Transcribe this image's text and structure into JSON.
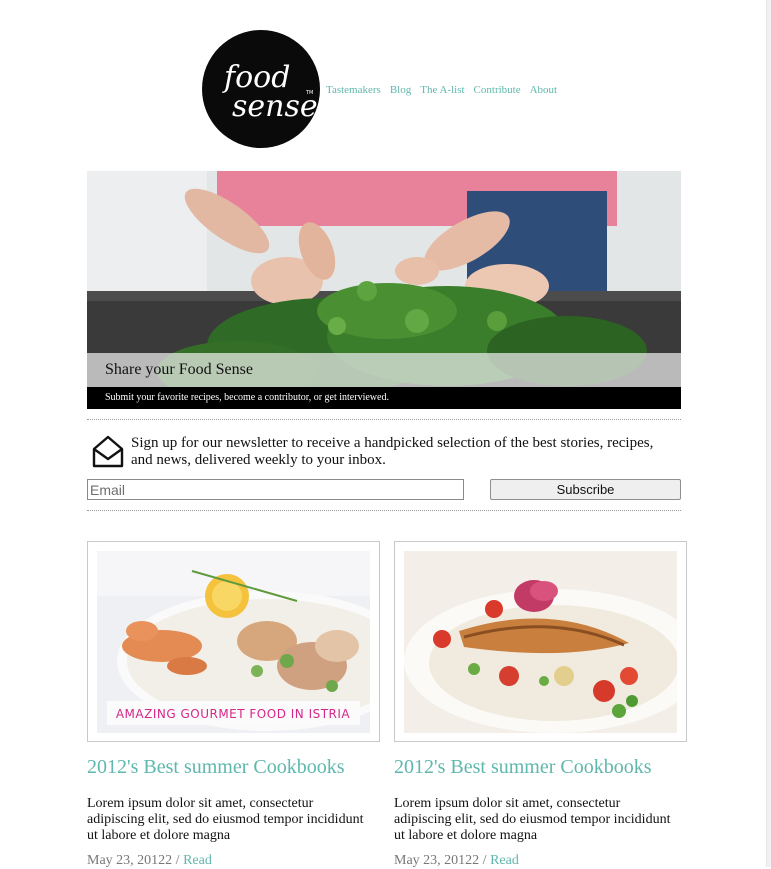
{
  "brand": {
    "logo_line1": "food",
    "logo_line2": "sense",
    "trademark": "TM"
  },
  "nav": [
    {
      "label": "Tastemakers"
    },
    {
      "label": "Blog"
    },
    {
      "label": "The A-list"
    },
    {
      "label": "Contribute"
    },
    {
      "label": "About"
    }
  ],
  "hero": {
    "title": "Share your Food Sense",
    "subtitle": "Submit your favorite recipes, become a contributor, or get interviewed."
  },
  "newsletter": {
    "text": "Sign up for our newsletter to receive a handpicked selection of the best stories, recipes, and news, delivered weekly to your inbox.",
    "email_placeholder": "Email",
    "subscribe_label": "Subscribe"
  },
  "cards": [
    {
      "image_caption": "AMAZING GOURMET FOOD IN ISTRIA",
      "title": "2012's Best summer Cookbooks",
      "excerpt": "Lorem ipsum dolor sit amet, consectetur adipiscing elit, sed do eiusmod tempor incididunt ut labore et dolore magna",
      "date": "May 23, 20122",
      "separator": "/",
      "read_label": "Read"
    },
    {
      "image_caption": "",
      "title": "2012's Best summer Cookbooks",
      "excerpt": "Lorem ipsum dolor sit amet, consectetur adipiscing elit, sed do eiusmod tempor incididunt ut labore et dolore magna",
      "date": "May 23, 20122",
      "separator": "/",
      "read_label": "Read"
    }
  ],
  "colors": {
    "accent": "#5fb7ad",
    "logo_bg": "#0a0a0a",
    "hero_bar": "#000000"
  },
  "icons": {
    "newsletter": "envelope-icon"
  }
}
